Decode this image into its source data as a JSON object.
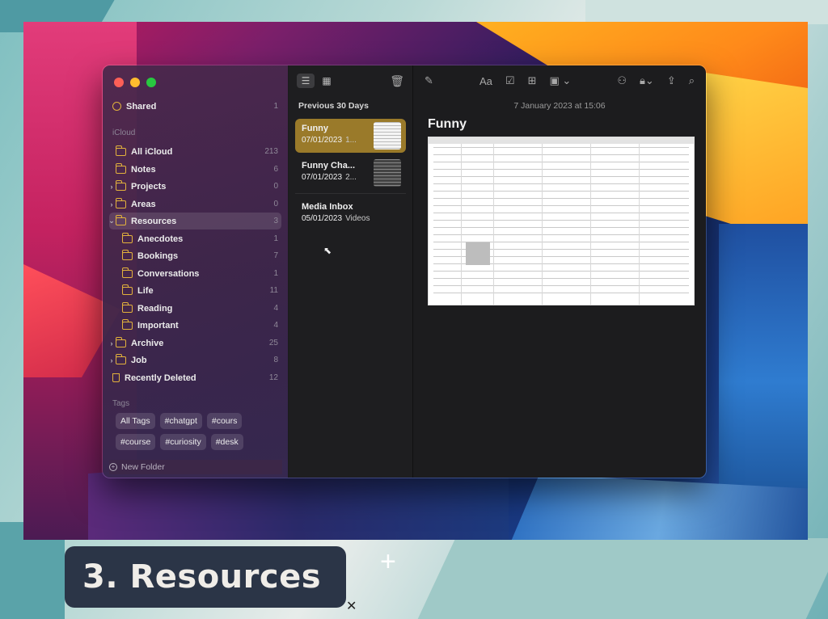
{
  "sidebar": {
    "shared": {
      "label": "Shared",
      "count": "1"
    },
    "icloud_header": "iCloud",
    "items": [
      {
        "label": "All iCloud",
        "count": "213"
      },
      {
        "label": "Notes",
        "count": "6"
      },
      {
        "label": "Projects",
        "count": "0"
      },
      {
        "label": "Areas",
        "count": "0"
      },
      {
        "label": "Resources",
        "count": "3"
      },
      {
        "label": "Anecdotes",
        "count": "1"
      },
      {
        "label": "Bookings",
        "count": "7"
      },
      {
        "label": "Conversations",
        "count": "1"
      },
      {
        "label": "Life",
        "count": "11"
      },
      {
        "label": "Reading",
        "count": "4"
      },
      {
        "label": "Important",
        "count": "4"
      },
      {
        "label": "Archive",
        "count": "25"
      },
      {
        "label": "Job",
        "count": "8"
      },
      {
        "label": "Recently Deleted",
        "count": "12"
      }
    ],
    "tags_header": "Tags",
    "tags": [
      "All Tags",
      "#chatgpt",
      "#cours",
      "#course",
      "#curiosity",
      "#desk"
    ],
    "new_folder": "New Folder"
  },
  "list": {
    "section": "Previous 30 Days",
    "notes": [
      {
        "title": "Funny",
        "date": "07/01/2023",
        "sub": "1..."
      },
      {
        "title": "Funny Cha...",
        "date": "07/01/2023",
        "sub": "2..."
      },
      {
        "title": "Media Inbox",
        "date": "05/01/2023",
        "sub": "Videos"
      }
    ]
  },
  "editor": {
    "date": "7 January 2023 at 15:06",
    "title": "Funny",
    "format_label": "Aa"
  },
  "caption": "3. Resources",
  "colors": {
    "accent": "#e3b23c",
    "selected_note": "#9a7a2a",
    "caption_bg": "#2b3547"
  }
}
